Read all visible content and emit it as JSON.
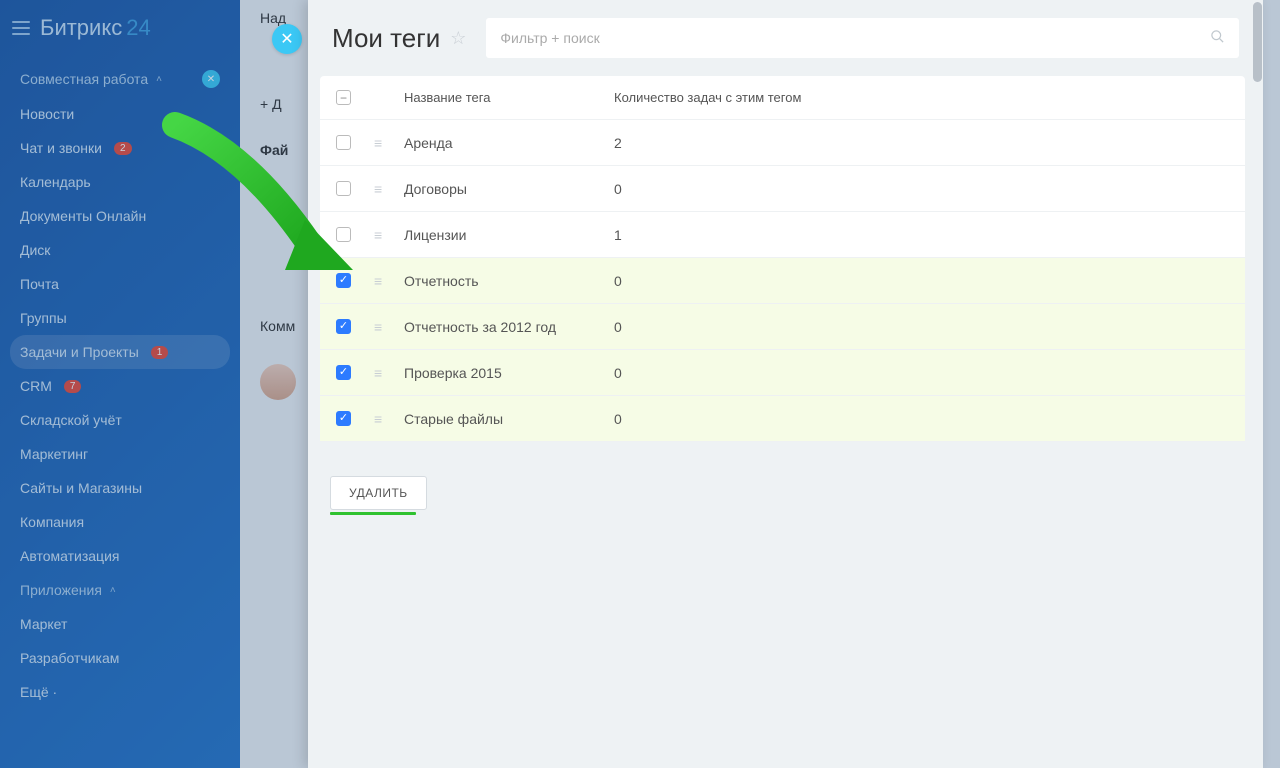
{
  "brand": {
    "name": "Битрикс",
    "suffix": "24"
  },
  "sidebar": {
    "items": [
      {
        "label": "Совместная работа",
        "type": "section",
        "chevron": true,
        "teal_close": true
      },
      {
        "label": "Новости"
      },
      {
        "label": "Чат и звонки",
        "badge": "2"
      },
      {
        "label": "Календарь"
      },
      {
        "label": "Документы Онлайн"
      },
      {
        "label": "Диск"
      },
      {
        "label": "Почта"
      },
      {
        "label": "Группы"
      },
      {
        "label": "Задачи и Проекты",
        "badge": "1",
        "active": true
      },
      {
        "label": "CRM",
        "badge": "7"
      },
      {
        "label": "Складской учёт"
      },
      {
        "label": "Маркетинг"
      },
      {
        "label": "Сайты и Магазины"
      },
      {
        "label": "Компания"
      },
      {
        "label": "Автоматизация"
      },
      {
        "label": "Приложения",
        "type": "section",
        "chevron": true
      },
      {
        "label": "Маркет"
      },
      {
        "label": "Разработчикам"
      },
      {
        "label": "Ещё ·"
      }
    ]
  },
  "bg": {
    "line1": "Над",
    "line2": "+ Д",
    "line3": "Фай",
    "line4": "Комм"
  },
  "modal": {
    "title": "Мои теги",
    "search_placeholder": "Фильтр + поиск",
    "columns": {
      "name": "Название тега",
      "count": "Количество задач с этим тегом"
    },
    "rows": [
      {
        "name": "Аренда",
        "count": "2",
        "checked": false
      },
      {
        "name": "Договоры",
        "count": "0",
        "checked": false
      },
      {
        "name": "Лицензии",
        "count": "1",
        "checked": false
      },
      {
        "name": "Отчетность",
        "count": "0",
        "checked": true
      },
      {
        "name": "Отчетность за 2012 год",
        "count": "0",
        "checked": true
      },
      {
        "name": "Проверка 2015",
        "count": "0",
        "checked": true
      },
      {
        "name": "Старые файлы",
        "count": "0",
        "checked": true
      }
    ],
    "delete_label": "УДАЛИТЬ"
  }
}
